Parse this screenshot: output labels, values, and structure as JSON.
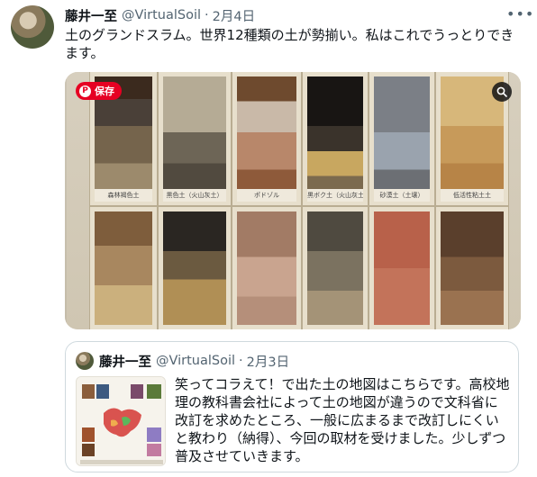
{
  "tweet": {
    "author_name": "藤井一至",
    "author_handle": "@VirtualSoil",
    "separator": "·",
    "date": "2月4日",
    "text": "土のグランドスラム。世界12種類の土が勢揃い。私はこれでうっとりできます。"
  },
  "media": {
    "save_label": "保存",
    "pin_glyph": "P",
    "soil_labels": [
      "森林褐色土",
      "黒色土（火山灰土）",
      "ポドゾル",
      "黒ボク土（火山灰土）",
      "砂漠土（土壌）",
      "低活性粘土土"
    ]
  },
  "quote": {
    "author_name": "藤井一至",
    "author_handle": "@VirtualSoil",
    "separator": "·",
    "date": "2月3日",
    "text": "笑ってコラえて！で出た土の地図はこちらです。高校地理の教科書会社によって土の地図が違うので文科省に改訂を求めたところ、一般に広まるまで改訂しにくいと教わり（納得）、今回の取材を受けました。少しずつ普及させていきます。"
  },
  "colors": {
    "accent": "#e60023",
    "secondary_text": "#536471",
    "border": "#cfd9de"
  }
}
